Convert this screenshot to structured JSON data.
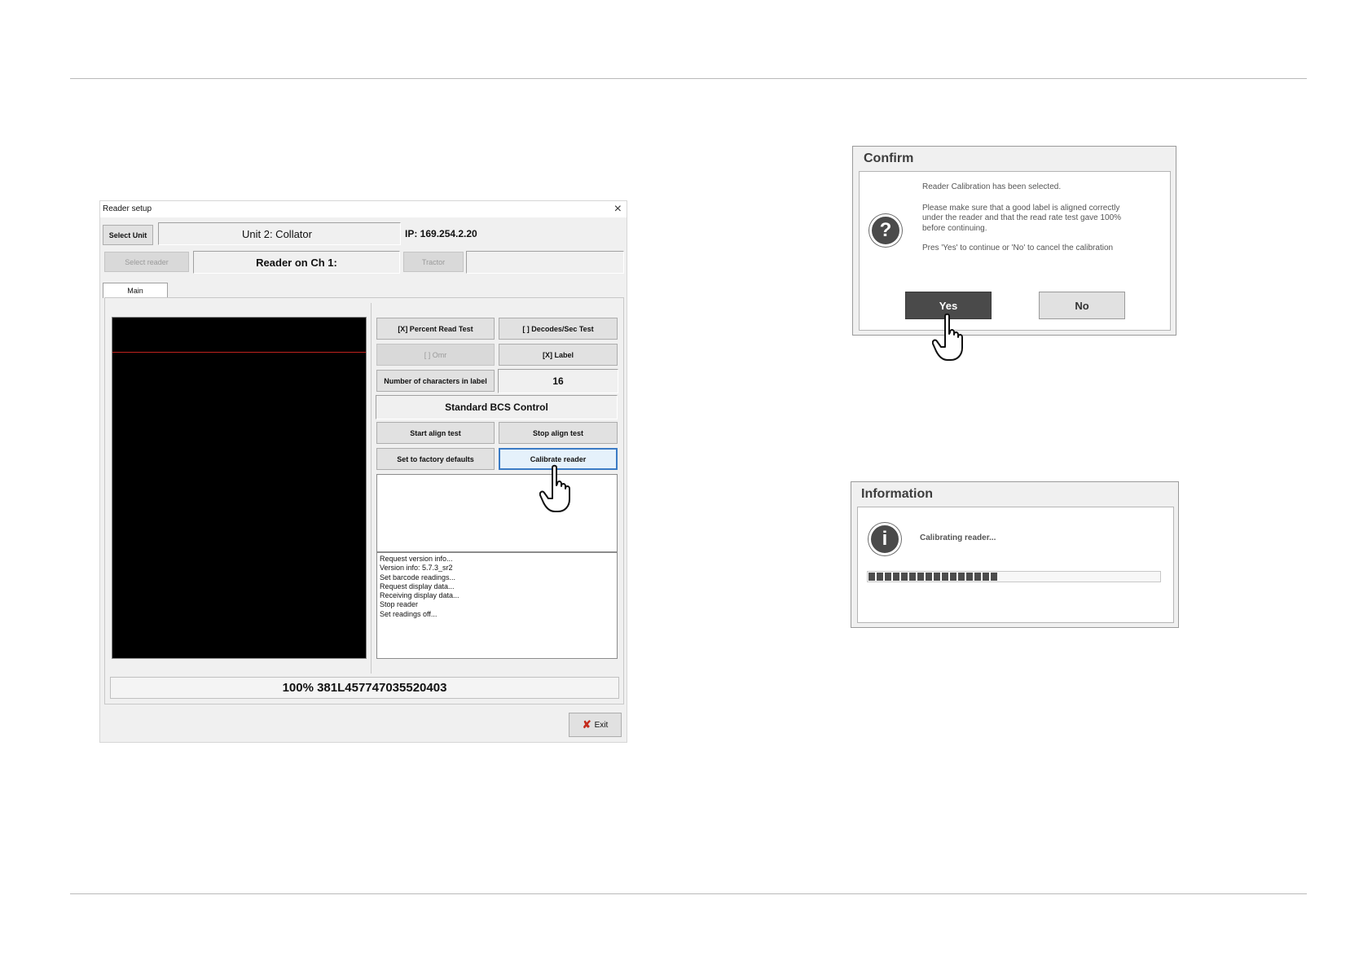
{
  "reader_setup": {
    "window_title": "Reader setup",
    "close_glyph": "×",
    "select_unit_label": "Select Unit",
    "unit_name": "Unit 2: Collator",
    "ip_label": "IP: 169.254.2.20",
    "select_reader_label": "Select reader",
    "reader_channel": "Reader on Ch 1:",
    "tractor_label": "Tractor",
    "tab_main": "Main",
    "percent_read_test": "[X] Percent Read Test",
    "decodes_sec_test": "[ ] Decodes/Sec Test",
    "omr_label": "[ ] Omr",
    "label_toggle": "[X] Label",
    "num_chars_label": "Number of characters in label",
    "num_chars_value": "16",
    "control_title": "Standard BCS Control",
    "start_align_test": "Start align test",
    "stop_align_test": "Stop align test",
    "factory_defaults": "Set to factory defaults",
    "calibrate_reader": "Calibrate reader",
    "log": [
      "Request version info...",
      "Version info: 5.7.3_sr2",
      "Set barcode readings...",
      "Request display data...",
      "Receiving display data...",
      "Stop reader",
      "Set readings off..."
    ],
    "status_line": "100% 381L457747035520403",
    "exit_label": "Exit"
  },
  "confirm_dialog": {
    "title": "Confirm",
    "icon": "question-icon",
    "line1": "Reader Calibration has been selected.",
    "line2a": "Please make sure that a good label is aligned correctly",
    "line2b": "under the reader and that the read rate test gave 100%",
    "line2c": "before continuing.",
    "line3": "Pres 'Yes' to continue or 'No' to cancel the calibration",
    "yes_label": "Yes",
    "no_label": "No"
  },
  "info_dialog": {
    "title": "Information",
    "icon": "info-icon",
    "message": "Calibrating reader...",
    "progress": 0.44
  },
  "colors": {
    "selected_border": "#3b7bc5",
    "yes_button": "#4a4a4a",
    "scan_line": "#c0221e"
  }
}
